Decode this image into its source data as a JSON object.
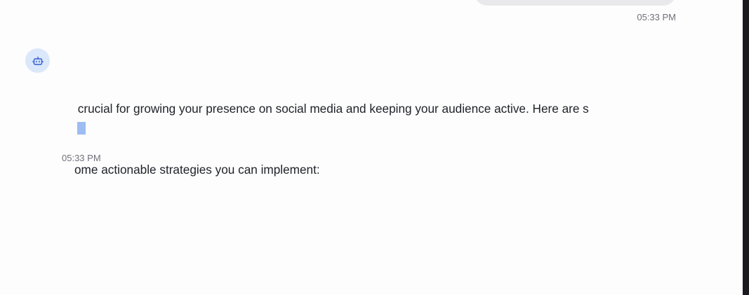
{
  "user_message": {
    "timestamp": "05:33 PM"
  },
  "bot_message": {
    "avatar_icon": "bot-icon",
    "lines": [
      " crucial for growing your presence on social media and keeping your audience active. Here are s",
      "ome actionable strategies you can implement:"
    ],
    "timestamp": "05:33 PM",
    "streaming": true
  },
  "colors": {
    "avatar_bg": "#dbe7fb",
    "avatar_icon": "#2f5fd0",
    "cursor": "#9dbcf2",
    "user_bubble": "#e9e9ec"
  }
}
